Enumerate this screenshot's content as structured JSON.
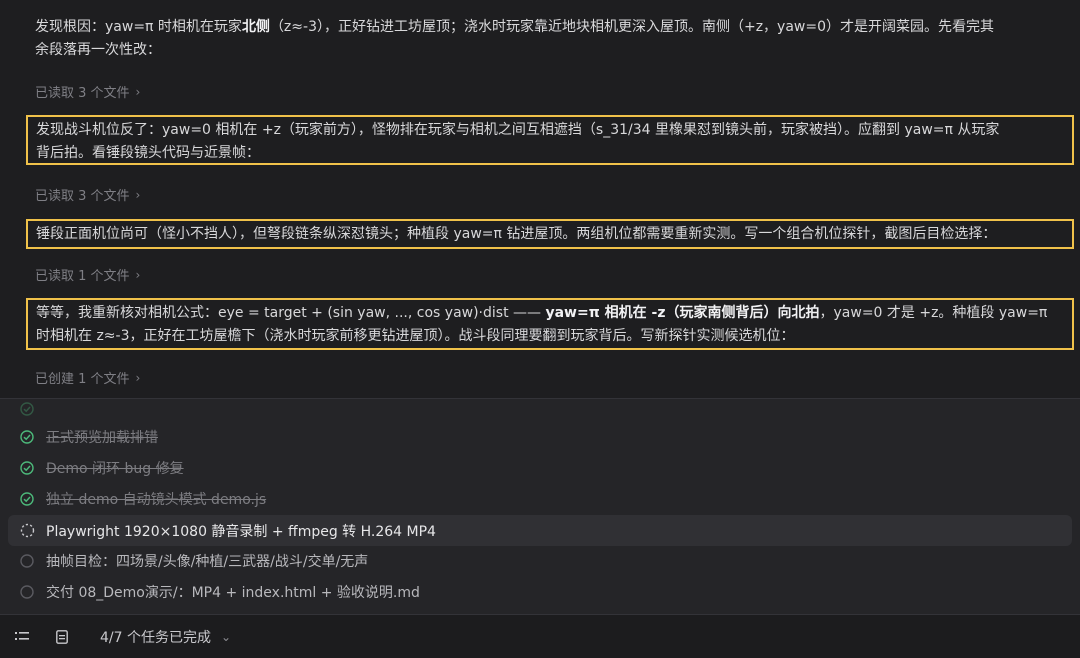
{
  "messages": {
    "p1_l1": "发现根因：yaw=π 时相机在玩家",
    "p1_bold": "北侧",
    "p1_l1b": "（z≈-3），正好钻进工坊屋顶；浇水时玩家靠近地块相机更深入屋顶。南侧（+z，yaw=0）才是开阔菜园。先看完其",
    "p1_l2": "余段落再一次性改：",
    "meta1": "已读取 3 个文件",
    "p2_l1": "发现战斗机位反了：yaw=0 相机在 +z（玩家前方），怪物排在玩家与相机之间互相遮挡（s_31/34 里橡果怼到镜头前，玩家被挡）。应翻到 yaw=π 从玩家",
    "p2_l2": "背后拍。看锤段镜头代码与近景帧：",
    "meta2": "已读取 3 个文件",
    "p3_l1": "锤段正面机位尚可（怪小不挡人），但弩段链条纵深怼镜头；种植段 yaw=π 钻进屋顶。两组机位都需要重新实测。写一个组合机位探针，截图后目检选择：",
    "meta3": "已读取 1 个文件",
    "p4_l1a": "等等，我重新核对相机公式：eye = target + (sin yaw, ..., cos yaw)·dist —— ",
    "p4_bold": "yaw=π 相机在 -z（玩家南侧背后）向北拍",
    "p4_l1b": "，yaw=0 才是 +z。种植段 yaw=π",
    "p4_l2": "时相机在 z≈-3，正好在工坊屋檐下（浇水时玩家前移更钻进屋顶）。战斗段同理要翻到玩家背后。写新探针实测候选机位：",
    "meta4": "已创建 1 个文件"
  },
  "tasks": [
    {
      "label": "正式预览加载排错",
      "state": "done"
    },
    {
      "label": "Demo 闭环 bug 修复",
      "state": "done"
    },
    {
      "label": "独立 demo 自动镜头模式 demo.js",
      "state": "done"
    },
    {
      "label": "Playwright 1920×1080 静音录制 + ffmpeg 转 H.264 MP4",
      "state": "active"
    },
    {
      "label": "抽帧目检：四场景/头像/种植/三武器/战斗/交单/无声",
      "state": "pending"
    },
    {
      "label": "交付 08_Demo演示/：MP4 + index.html + 验收说明.md",
      "state": "pending"
    }
  ],
  "footer": {
    "status": "4/7 个任务已完成",
    "expand_glyph": "⌄"
  },
  "colors": {
    "highlight_border": "#f0c24a",
    "done_check": "#4cb87a"
  },
  "icons": {
    "done": "check-circle-icon",
    "active": "spinner-icon",
    "pending": "empty-circle-icon",
    "tasks_toggle": "task-list-icon",
    "doc": "document-icon",
    "chevron": "chevron-right-icon"
  }
}
